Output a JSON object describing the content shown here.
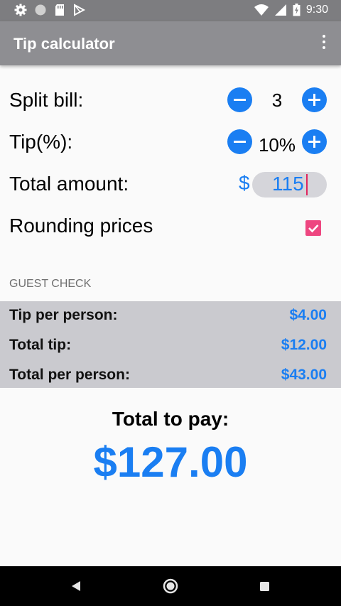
{
  "status_bar": {
    "time": "9:30",
    "left_icons": [
      "gear-icon",
      "circle-icon",
      "sd-card-icon",
      "play-store-icon"
    ],
    "right_icons": [
      "wifi-icon",
      "signal-icon",
      "battery-icon"
    ]
  },
  "app_bar": {
    "title": "Tip calculator",
    "menu_icon": "more-vert-icon"
  },
  "split": {
    "label": "Split bill:",
    "value": "3"
  },
  "tip": {
    "label": "Tip(%):",
    "value": "10%"
  },
  "amount": {
    "label": "Total amount:",
    "currency": "$",
    "value": "115"
  },
  "rounding": {
    "label": "Rounding prices",
    "checked": true
  },
  "guest_check": {
    "header": "GUEST CHECK",
    "rows": [
      {
        "label": "Tip per person:",
        "value": "$4.00"
      },
      {
        "label": "Total tip:",
        "value": "$12.00"
      },
      {
        "label": "Total per person:",
        "value": "$43.00"
      }
    ]
  },
  "total": {
    "label": "Total to pay:",
    "value": "$127.00"
  },
  "colors": {
    "accent": "#1a7ef2",
    "checkbox": "#ee4680",
    "app_bar": "#8e8e92",
    "panel": "#cacacf"
  },
  "nav_bar": {
    "icons": [
      "back-icon",
      "home-icon",
      "recents-icon"
    ]
  }
}
